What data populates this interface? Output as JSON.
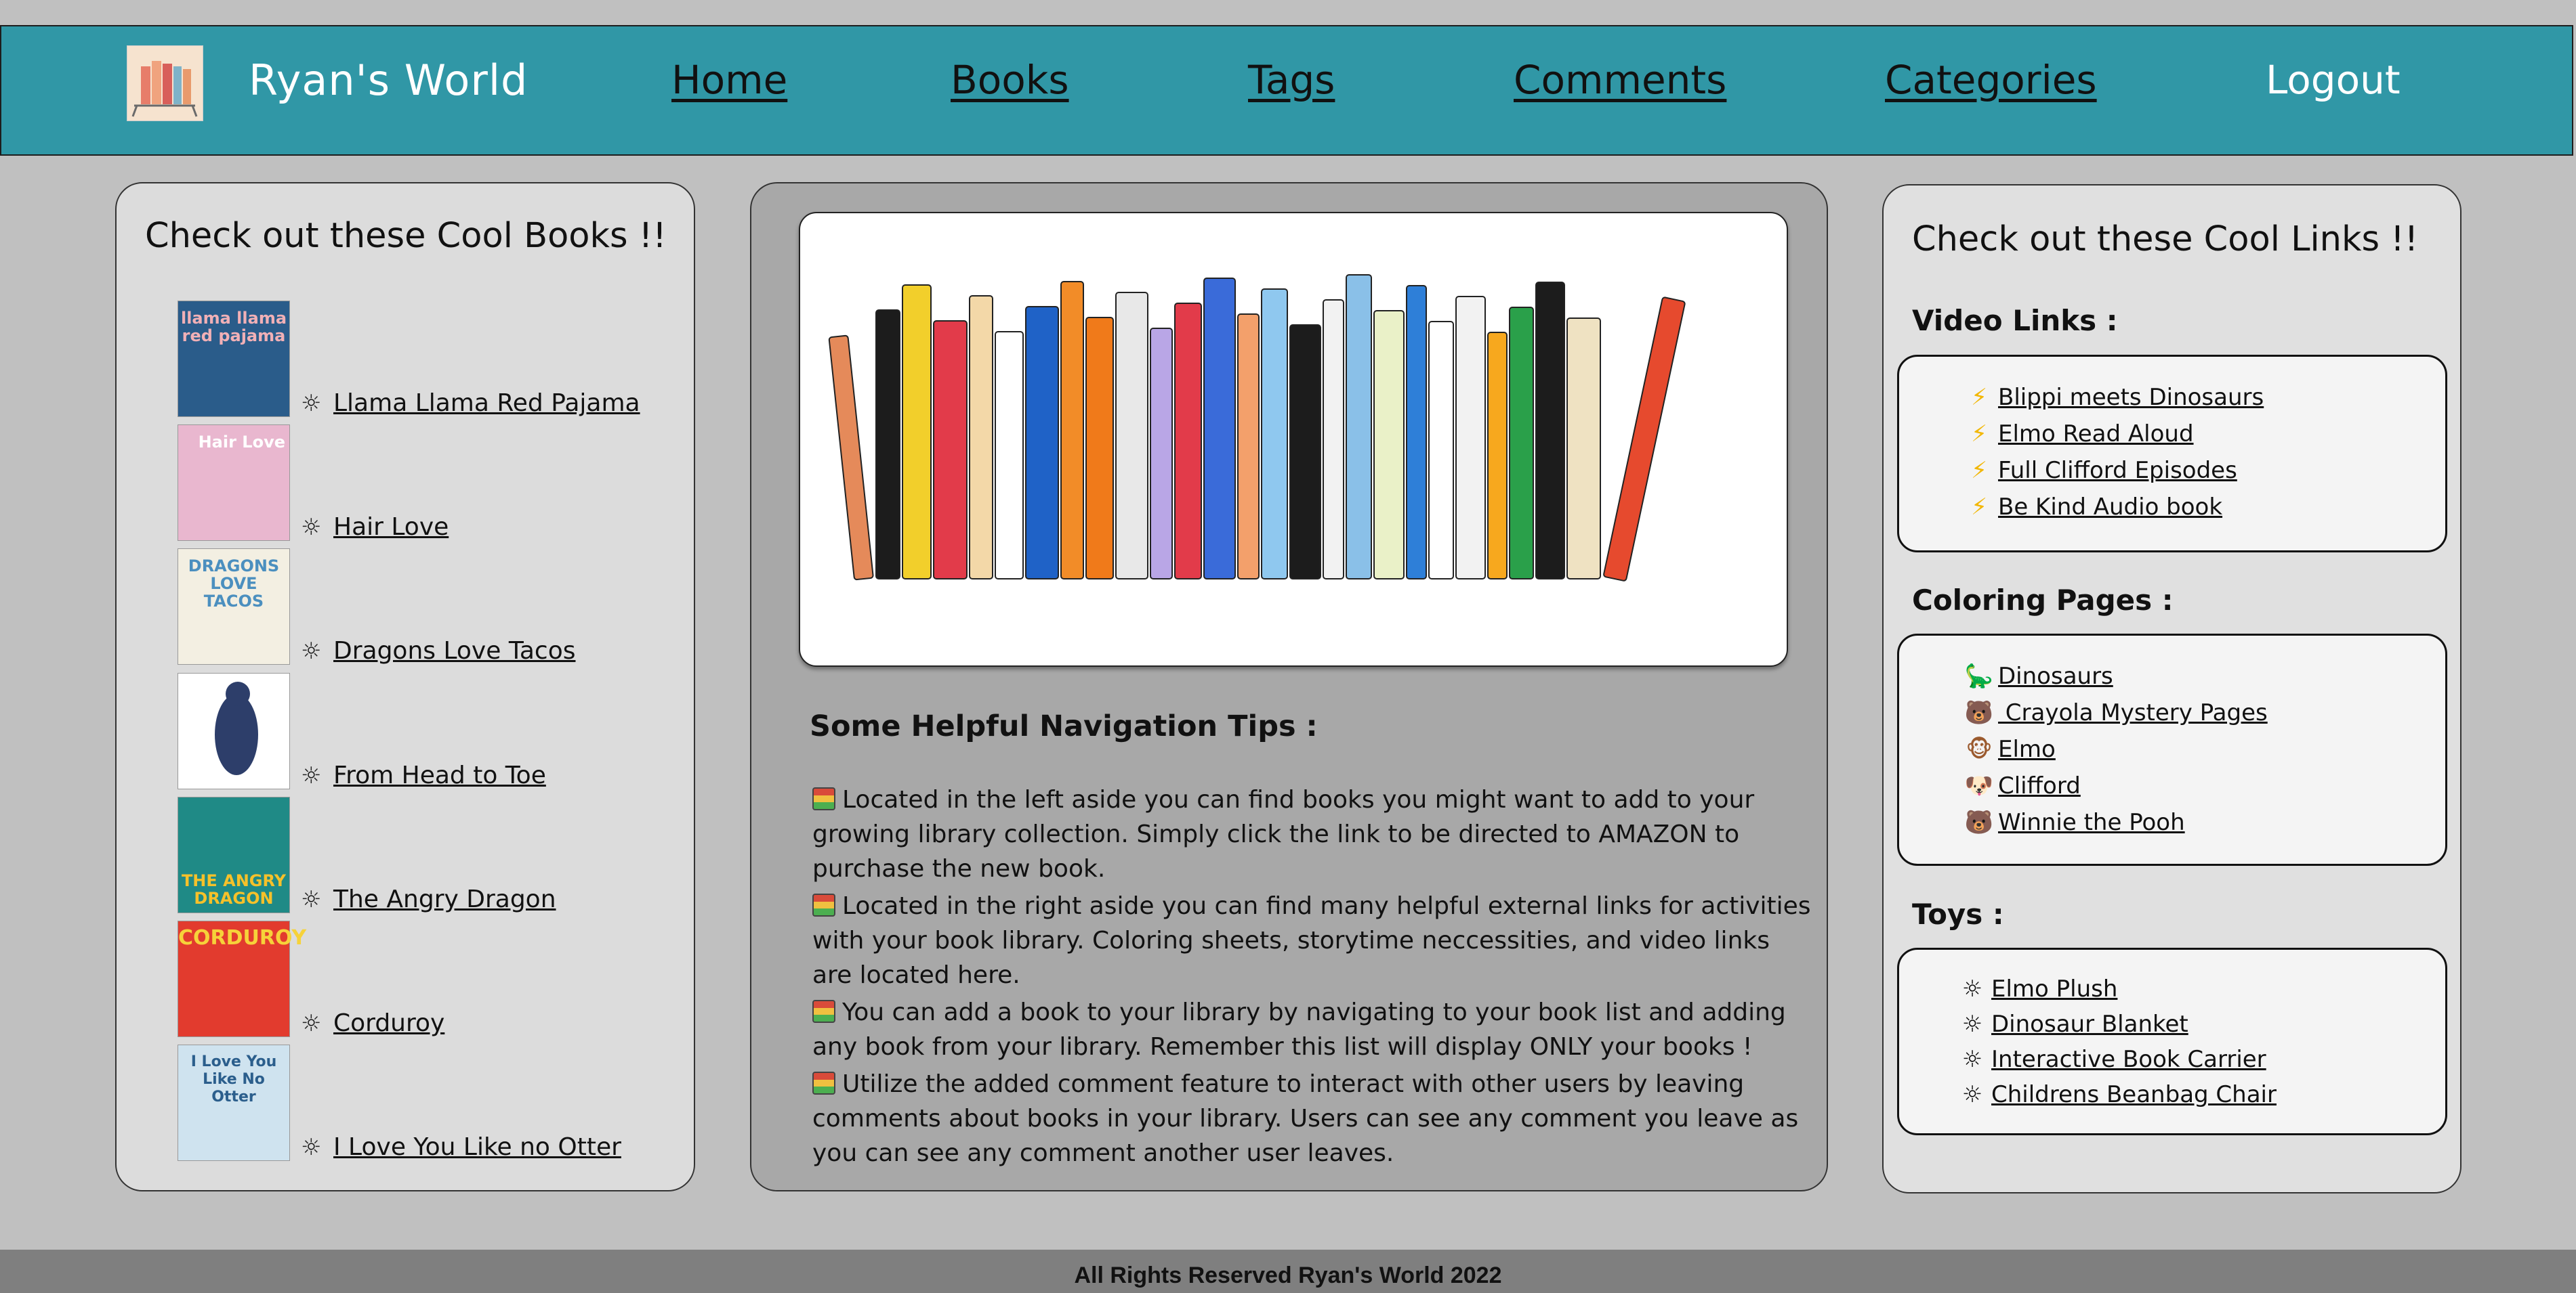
{
  "header": {
    "brand": "Ryan's World",
    "nav": [
      "Home",
      "Books",
      "Tags",
      "Comments",
      "Categories",
      "Logout"
    ]
  },
  "left": {
    "title": "Check out these Cool Books !!",
    "books": [
      {
        "title": "Llama Llama Red Pajama",
        "cover_text": "llama llama red pajama",
        "cover_color": "#2a5c8a"
      },
      {
        "title": "Hair Love",
        "cover_text": "Hair Love",
        "cover_color": "#e9b7cf"
      },
      {
        "title": "Dragons Love Tacos",
        "cover_text": "DRAGONS LOVE TACOS",
        "cover_color": "#f3efe2"
      },
      {
        "title": "From Head to Toe",
        "cover_text": "",
        "cover_color": "#ffffff"
      },
      {
        "title": "The Angry Dragon",
        "cover_text": "THE ANGRY DRAGON",
        "cover_color": "#1f8a86"
      },
      {
        "title": "Corduroy",
        "cover_text": "CORDUROY",
        "cover_color": "#e23b2e"
      },
      {
        "title": "I Love You Like no Otter",
        "cover_text": "I Love You Like No Otter",
        "cover_color": "#cfe3ef"
      }
    ]
  },
  "center": {
    "tips_title": "Some Helpful Navigation Tips :",
    "tips": [
      "Located in the left aside you can find books you might want to add to your growing library collection. Simply click the link to be directed to AMAZON to purchase the new book.",
      "Located in the right aside you can find many helpful external links for activities with your book library. Coloring sheets, storytime neccessities, and video links are located here.",
      "You can add a book to your library by navigating to your book list and adding any book from your library. Remember this list will display ONLY your books !",
      "Utilize the added comment feature to interact with other users by leaving comments about books in your library. Users can see any comment you leave as you can see any comment another user leaves."
    ]
  },
  "right": {
    "title": "Check out these Cool Links !!",
    "video_label": "Video Links :",
    "video_links": [
      "Blippi meets Dinosaurs",
      "Elmo Read Aloud",
      "Full Clifford Episodes",
      "Be Kind Audio book"
    ],
    "coloring_label": "Coloring Pages :",
    "coloring_links": [
      {
        "label": "Dinosaurs",
        "icon": "dinosaur-icon"
      },
      {
        "label": " Crayola Mystery Pages",
        "icon": "bear-icon"
      },
      {
        "label": "Elmo",
        "icon": "monkey-icon"
      },
      {
        "label": "Clifford",
        "icon": "dog-icon"
      },
      {
        "label": "Winnie the Pooh",
        "icon": "bear-icon"
      }
    ],
    "toys_label": "Toys :",
    "toys_links": [
      "Elmo Plush",
      "Dinosaur Blanket",
      "Interactive Book Carrier",
      "Childrens Beanbag Chair"
    ]
  },
  "footer": {
    "text": "All Rights Reserved Ryan's World 2022"
  },
  "colors": {
    "header": "#3097a6",
    "page": "#c0c0c0",
    "footer": "#7f7f7f"
  }
}
